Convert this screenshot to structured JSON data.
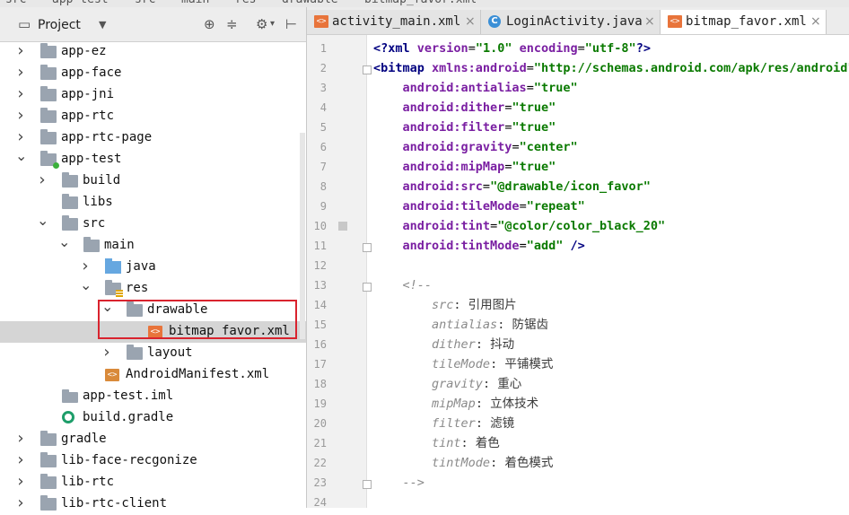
{
  "breadcrumbs": [
    "src",
    "app-test",
    "src",
    "main",
    "res",
    "drawable",
    "bitmap_favor.xml"
  ],
  "project_panel": {
    "title": "Project",
    "dropdown_icon": "chevron-down-icon",
    "toolbar_icons": [
      "target-icon",
      "collapse-icon",
      "gear-icon",
      "hide-panel-icon"
    ]
  },
  "tree": [
    {
      "label": "app-ez",
      "depth": 0,
      "arrow": "right",
      "icon": "folder"
    },
    {
      "label": "app-face",
      "depth": 0,
      "arrow": "right",
      "icon": "folder"
    },
    {
      "label": "app-jni",
      "depth": 0,
      "arrow": "right",
      "icon": "folder"
    },
    {
      "label": "app-rtc",
      "depth": 0,
      "arrow": "right",
      "icon": "folder"
    },
    {
      "label": "app-rtc-page",
      "depth": 0,
      "arrow": "right",
      "icon": "folder"
    },
    {
      "label": "app-test",
      "depth": 0,
      "arrow": "down",
      "icon": "module-folder"
    },
    {
      "label": "build",
      "depth": 1,
      "arrow": "right",
      "icon": "folder"
    },
    {
      "label": "libs",
      "depth": 1,
      "arrow": "none",
      "icon": "folder"
    },
    {
      "label": "src",
      "depth": 1,
      "arrow": "down",
      "icon": "folder"
    },
    {
      "label": "main",
      "depth": 2,
      "arrow": "down",
      "icon": "folder"
    },
    {
      "label": "java",
      "depth": 3,
      "arrow": "right",
      "icon": "folder-blue"
    },
    {
      "label": "res",
      "depth": 3,
      "arrow": "down",
      "icon": "res-folder"
    },
    {
      "label": "drawable",
      "depth": 4,
      "arrow": "down",
      "icon": "folder"
    },
    {
      "label": "bitmap_favor.xml",
      "depth": 5,
      "arrow": "none",
      "icon": "xml",
      "selected": true
    },
    {
      "label": "layout",
      "depth": 4,
      "arrow": "right",
      "icon": "folder"
    },
    {
      "label": "AndroidManifest.xml",
      "depth": 3,
      "arrow": "none",
      "icon": "manifest"
    },
    {
      "label": "app-test.iml",
      "depth": 1,
      "arrow": "none",
      "icon": "iml"
    },
    {
      "label": "build.gradle",
      "depth": 1,
      "arrow": "none",
      "icon": "gradle"
    },
    {
      "label": "gradle",
      "depth": 0,
      "arrow": "right",
      "icon": "folder"
    },
    {
      "label": "lib-face-recgonize",
      "depth": 0,
      "arrow": "right",
      "icon": "folder"
    },
    {
      "label": "lib-rtc",
      "depth": 0,
      "arrow": "right",
      "icon": "folder"
    },
    {
      "label": "lib-rtc-client",
      "depth": 0,
      "arrow": "right",
      "icon": "folder"
    }
  ],
  "tabs": [
    {
      "label": "activity_main.xml",
      "icon": "xml-icon",
      "active": false
    },
    {
      "label": "LoginActivity.java",
      "icon": "class-icon",
      "active": false
    },
    {
      "label": "bitmap_favor.xml",
      "icon": "xml-icon",
      "active": true
    }
  ],
  "colors": {
    "highlight_border": "#d9232e",
    "selected_row": "#d5d5d5",
    "xml_icon": "#e8743b"
  },
  "code_lines": [
    {
      "n": "1",
      "parts": [
        [
          "kw",
          "<?"
        ],
        [
          "kw",
          "xml "
        ],
        [
          "attr",
          "version"
        ],
        [
          "pl",
          "="
        ],
        [
          "val",
          "\"1.0\" "
        ],
        [
          "attr",
          "encoding"
        ],
        [
          "pl",
          "="
        ],
        [
          "val",
          "\"utf-8\""
        ],
        [
          "kw",
          "?>"
        ]
      ]
    },
    {
      "n": "2",
      "parts": [
        [
          "kw",
          "<bitmap "
        ],
        [
          "ns",
          "xmlns:android"
        ],
        [
          "pl",
          "="
        ],
        [
          "val",
          "\"http://schemas.android.com/apk/res/android\""
        ]
      ]
    },
    {
      "n": "3",
      "parts": [
        [
          "pl",
          "    "
        ],
        [
          "ns",
          "android:antialias"
        ],
        [
          "pl",
          "="
        ],
        [
          "val",
          "\"true\""
        ]
      ]
    },
    {
      "n": "4",
      "parts": [
        [
          "pl",
          "    "
        ],
        [
          "ns",
          "android:dither"
        ],
        [
          "pl",
          "="
        ],
        [
          "val",
          "\"true\""
        ]
      ]
    },
    {
      "n": "5",
      "parts": [
        [
          "pl",
          "    "
        ],
        [
          "ns",
          "android:filter"
        ],
        [
          "pl",
          "="
        ],
        [
          "val",
          "\"true\""
        ]
      ]
    },
    {
      "n": "6",
      "parts": [
        [
          "pl",
          "    "
        ],
        [
          "ns",
          "android:gravity"
        ],
        [
          "pl",
          "="
        ],
        [
          "val",
          "\"center\""
        ]
      ]
    },
    {
      "n": "7",
      "parts": [
        [
          "pl",
          "    "
        ],
        [
          "ns",
          "android:mipMap"
        ],
        [
          "pl",
          "="
        ],
        [
          "val",
          "\"true\""
        ]
      ]
    },
    {
      "n": "8",
      "parts": [
        [
          "pl",
          "    "
        ],
        [
          "ns",
          "android:src"
        ],
        [
          "pl",
          "="
        ],
        [
          "val",
          "\"@drawable/icon_favor\""
        ]
      ]
    },
    {
      "n": "9",
      "parts": [
        [
          "pl",
          "    "
        ],
        [
          "ns",
          "android:tileMode"
        ],
        [
          "pl",
          "="
        ],
        [
          "val",
          "\"repeat\""
        ]
      ]
    },
    {
      "n": "10",
      "parts": [
        [
          "pl",
          "    "
        ],
        [
          "ns",
          "android:tint"
        ],
        [
          "pl",
          "="
        ],
        [
          "val",
          "\"@color/color_black_20\""
        ]
      ]
    },
    {
      "n": "11",
      "parts": [
        [
          "pl",
          "    "
        ],
        [
          "ns",
          "android:tintMode"
        ],
        [
          "pl",
          "="
        ],
        [
          "val",
          "\"add\" "
        ],
        [
          "kw",
          "/>"
        ]
      ]
    },
    {
      "n": "12",
      "parts": []
    },
    {
      "n": "13",
      "parts": [
        [
          "pl",
          "    "
        ],
        [
          "cm",
          "<!--"
        ]
      ]
    },
    {
      "n": "14",
      "parts": [
        [
          "pl",
          "        "
        ],
        [
          "cm",
          "src"
        ],
        [
          "cmt",
          ": 引用图片"
        ]
      ]
    },
    {
      "n": "15",
      "parts": [
        [
          "pl",
          "        "
        ],
        [
          "cm",
          "antialias"
        ],
        [
          "cmt",
          ": 防锯齿"
        ]
      ]
    },
    {
      "n": "16",
      "parts": [
        [
          "pl",
          "        "
        ],
        [
          "cm",
          "dither"
        ],
        [
          "cmt",
          ": 抖动"
        ]
      ]
    },
    {
      "n": "17",
      "parts": [
        [
          "pl",
          "        "
        ],
        [
          "cm",
          "tileMode"
        ],
        [
          "cmt",
          ": 平铺模式"
        ]
      ]
    },
    {
      "n": "18",
      "parts": [
        [
          "pl",
          "        "
        ],
        [
          "cm",
          "gravity"
        ],
        [
          "cmt",
          ": 重心"
        ]
      ]
    },
    {
      "n": "19",
      "parts": [
        [
          "pl",
          "        "
        ],
        [
          "cm",
          "mipMap"
        ],
        [
          "cmt",
          ": 立体技术"
        ]
      ]
    },
    {
      "n": "20",
      "parts": [
        [
          "pl",
          "        "
        ],
        [
          "cm",
          "filter"
        ],
        [
          "cmt",
          ": 滤镜"
        ]
      ]
    },
    {
      "n": "21",
      "parts": [
        [
          "pl",
          "        "
        ],
        [
          "cm",
          "tint"
        ],
        [
          "cmt",
          ": 着色"
        ]
      ]
    },
    {
      "n": "22",
      "parts": [
        [
          "pl",
          "        "
        ],
        [
          "cm",
          "tintMode"
        ],
        [
          "cmt",
          ": 着色模式"
        ]
      ]
    },
    {
      "n": "23",
      "parts": [
        [
          "pl",
          "    "
        ],
        [
          "cm",
          "-->"
        ]
      ]
    },
    {
      "n": "24",
      "parts": []
    }
  ]
}
